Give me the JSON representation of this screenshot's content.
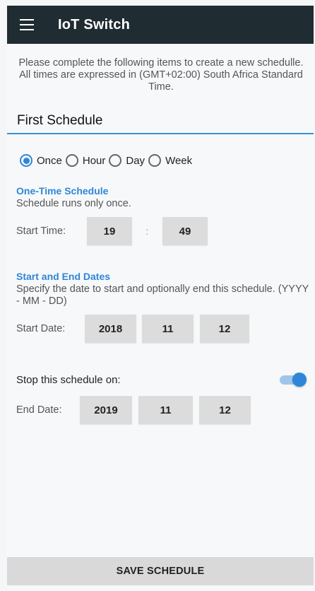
{
  "app": {
    "title": "IoT Switch"
  },
  "intro": "Please complete the following items to create a new schedulle. All times are expressed in (GMT+02:00) South Africa Standard Time.",
  "schedule_name": "First Schedule",
  "frequency": {
    "selected": "Once",
    "options": [
      "Once",
      "Hour",
      "Day",
      "Week"
    ]
  },
  "one_time": {
    "title": "One-Time Schedule",
    "description": "Schedule runs only once.",
    "start_time_label": "Start Time:",
    "hour": "19",
    "separator": ":",
    "minute": "49"
  },
  "dates": {
    "title": "Start and End Dates",
    "description": "Specify the date to start and optionally end this schedule. (YYYY - MM - DD)",
    "start_label": "Start Date:",
    "start": {
      "year": "2018",
      "month": "11",
      "day": "12"
    },
    "stop_label": "Stop this schedule on:",
    "stop_enabled": true,
    "end_label": "End Date:",
    "end": {
      "year": "2019",
      "month": "11",
      "day": "12"
    }
  },
  "actions": {
    "save_label": "SAVE SCHEDULE"
  },
  "colors": {
    "accent": "#2f86d8",
    "appbar": "#1f2c32",
    "button": "#d9d9d9"
  }
}
